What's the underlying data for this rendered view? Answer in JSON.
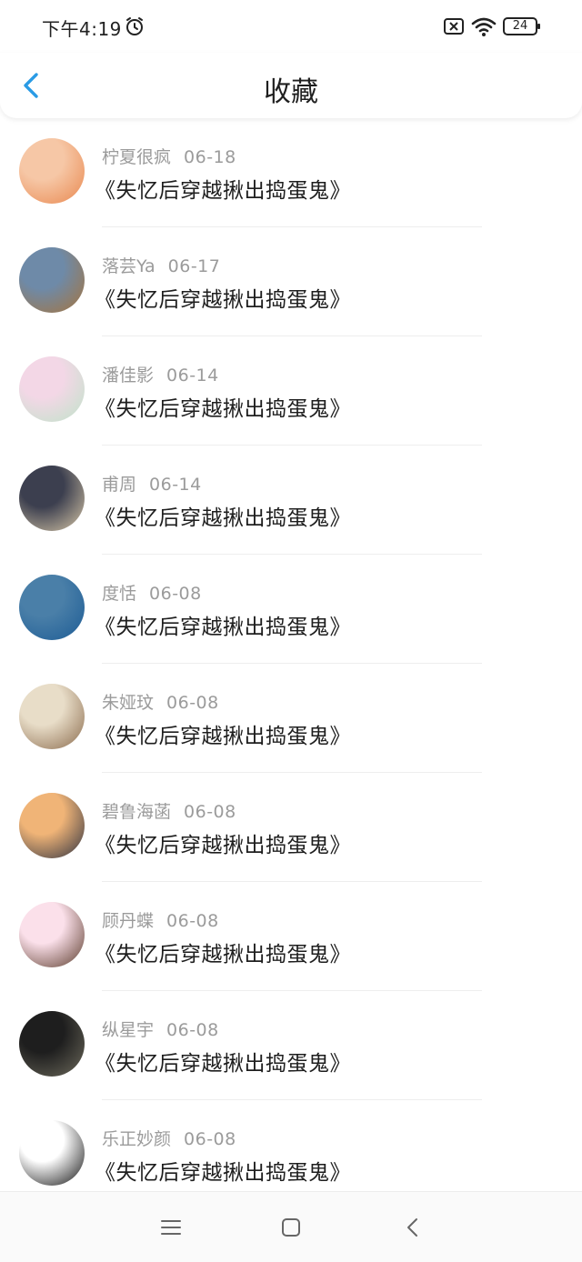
{
  "status_bar": {
    "time": "下午4:19",
    "battery": "24",
    "icons": [
      "alarm-icon",
      "sim-error-icon",
      "wifi-icon",
      "battery-icon"
    ]
  },
  "header": {
    "title": "收藏",
    "back_icon": "chevron-left-icon",
    "accent_color": "#2a9be5"
  },
  "favorites": [
    {
      "user": "柠夏很疯",
      "date": "06-18",
      "title": "《失忆后穿越揪出捣蛋鬼》",
      "avatar_colors": [
        "#f6c7a6",
        "#e9884f"
      ]
    },
    {
      "user": "落芸Ya",
      "date": "06-17",
      "title": "《失忆后穿越揪出捣蛋鬼》",
      "avatar_colors": [
        "#6e8aa8",
        "#a6743c"
      ]
    },
    {
      "user": "潘佳影",
      "date": "06-14",
      "title": "《失忆后穿越揪出捣蛋鬼》",
      "avatar_colors": [
        "#f3d7e6",
        "#bfe3c9"
      ]
    },
    {
      "user": "甫周",
      "date": "06-14",
      "title": "《失忆后穿越揪出捣蛋鬼》",
      "avatar_colors": [
        "#3c3f4f",
        "#d8c8a8"
      ]
    },
    {
      "user": "度恬",
      "date": "06-08",
      "title": "《失忆后穿越揪出捣蛋鬼》",
      "avatar_colors": [
        "#4a7fa8",
        "#1d5c95"
      ]
    },
    {
      "user": "朱娅玟",
      "date": "06-08",
      "title": "《失忆后穿越揪出捣蛋鬼》",
      "avatar_colors": [
        "#e8ddc8",
        "#8a6a4c"
      ]
    },
    {
      "user": "碧鲁海菡",
      "date": "06-08",
      "title": "《失忆后穿越揪出捣蛋鬼》",
      "avatar_colors": [
        "#f0b477",
        "#2d3140"
      ]
    },
    {
      "user": "顾丹蝶",
      "date": "06-08",
      "title": "《失忆后穿越揪出捣蛋鬼》",
      "avatar_colors": [
        "#fbe0ea",
        "#5a3a2a"
      ]
    },
    {
      "user": "纵星宇",
      "date": "06-08",
      "title": "《失忆后穿越揪出捣蛋鬼》",
      "avatar_colors": [
        "#1e1e1e",
        "#6d6a5c"
      ]
    },
    {
      "user": "乐正妙颜",
      "date": "06-08",
      "title": "《失忆后穿越揪出捣蛋鬼》",
      "avatar_colors": [
        "#ffffff",
        "#111111"
      ]
    }
  ],
  "nav": {
    "menu_icon": "menu-icon",
    "home_icon": "home-square-icon",
    "back_icon": "back-triangle-icon"
  }
}
